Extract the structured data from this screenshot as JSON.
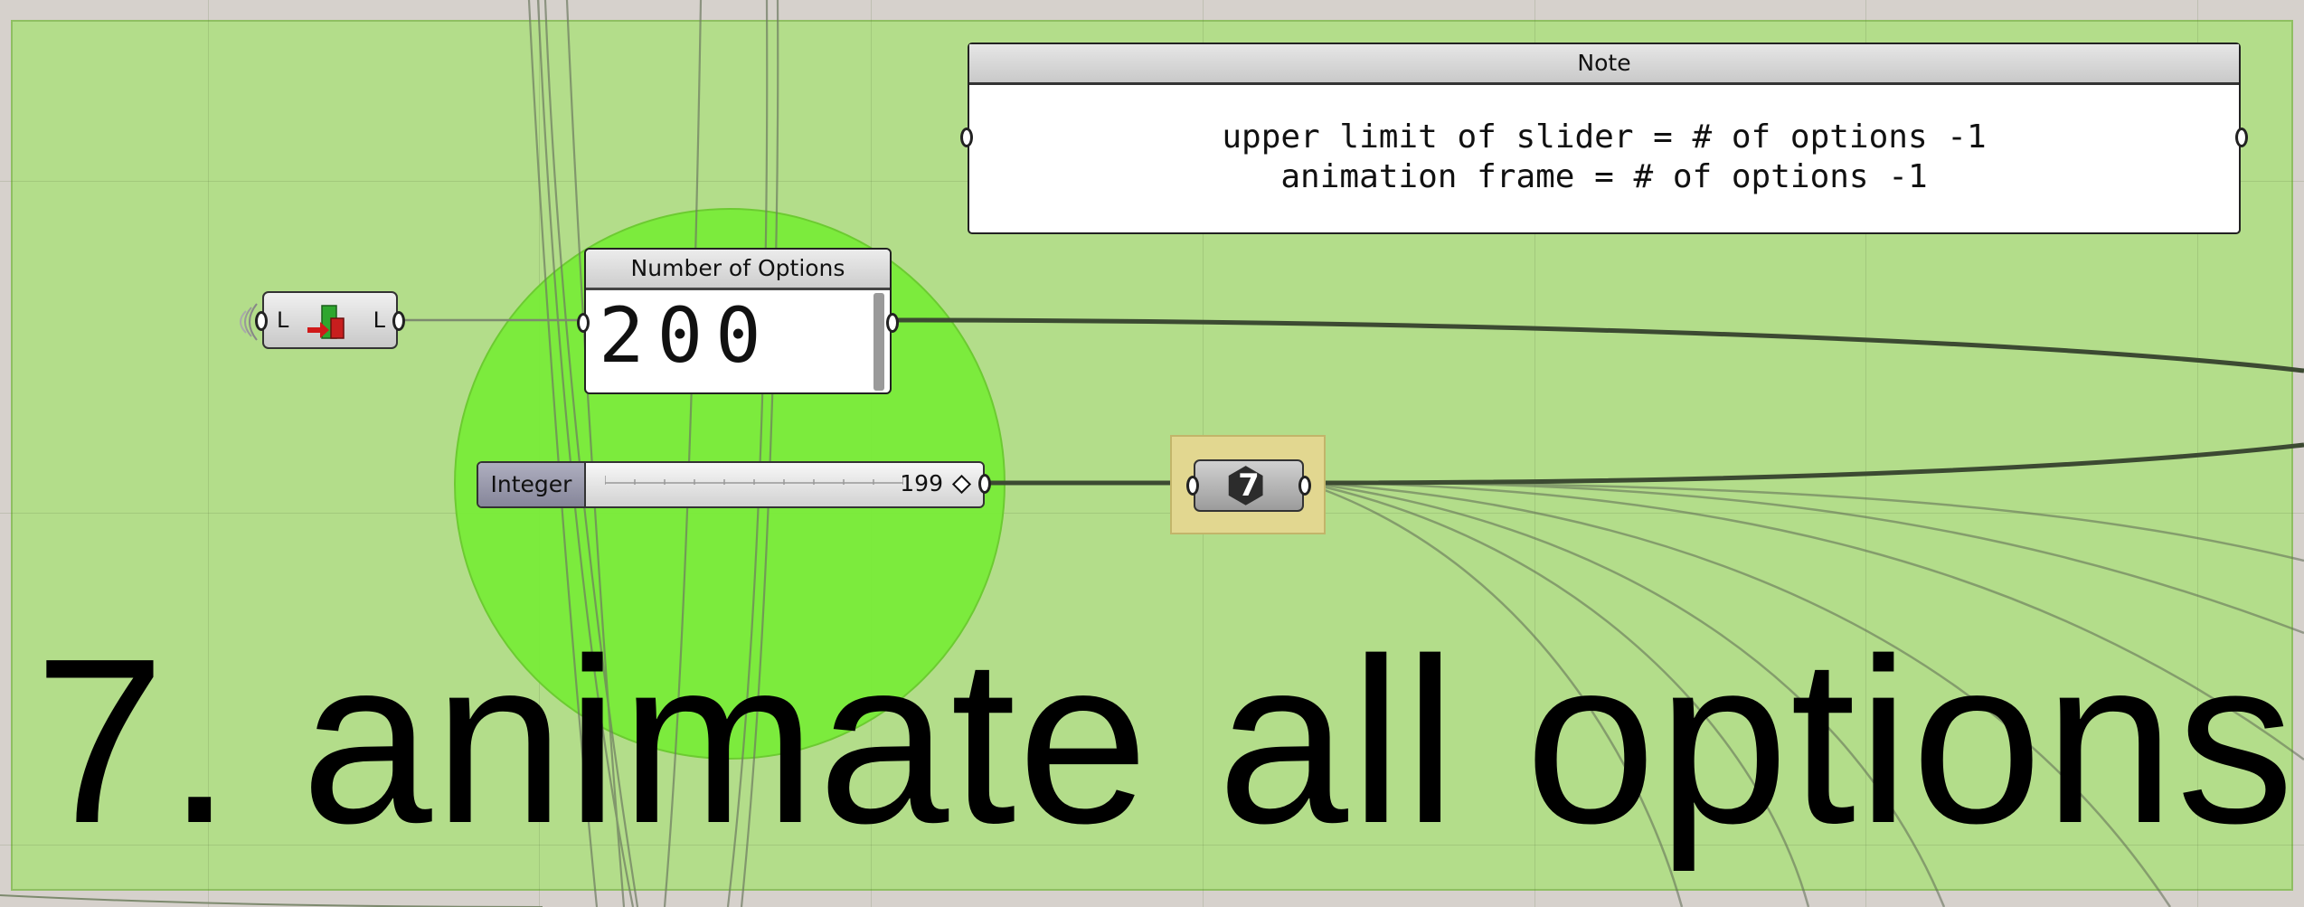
{
  "note": {
    "title": "Note",
    "line1": "upper limit of slider = # of options -1",
    "line2": "animation frame = # of options -1"
  },
  "number_panel": {
    "title": "Number of Options",
    "value": "200"
  },
  "data_component": {
    "input_label": "L",
    "output_label": "L",
    "icon": "list-data-icon"
  },
  "slider": {
    "name": "Integer",
    "value": "199"
  },
  "counter": {
    "value": "7",
    "icon": "hexagon-icon"
  },
  "heading": "7. animate all options",
  "colors": {
    "group_fill": "#b3dd8a",
    "circle_fill": "#7aec3a",
    "counter_group": "#e2d790",
    "canvas_bg": "#d6d1cc"
  }
}
